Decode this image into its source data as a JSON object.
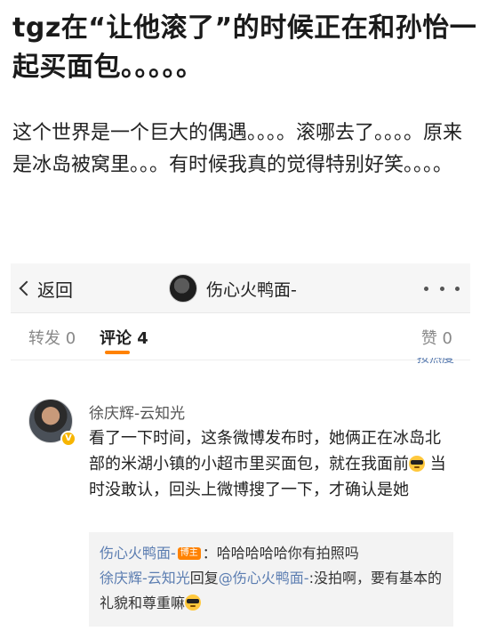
{
  "post": {
    "title": "tgz在“让他滚了”的时候正在和孙怡一起买面包。。。。。",
    "body": "这个世界是一个巨大的偶遇。。。。滚哪去了。。。。原来是冰岛被窝里。。。有时候我真的觉得特别好笑。。。。"
  },
  "navbar": {
    "back_label": "返回",
    "title": "伤心火鸭面-"
  },
  "tabs": {
    "repost": "转发 0",
    "comment": "评论 4",
    "like": "赞 0",
    "sort_hint": "按热度"
  },
  "comment": {
    "author": "徐庆辉-云知光",
    "text_part1": "看了一下时间，这条微博发布时，她俩正在冰岛北部的米湖小镇的小超市里买面包，就在我面前",
    "text_part2": " 当时没敢认，回头上微博搜了一下，才确认是她",
    "emoji_name": "cool-sunglasses-emoji",
    "verify_color": "#f7b500"
  },
  "replies": [
    {
      "author": "伤心火鸭面-",
      "tag": "博主",
      "text": "：哈哈哈哈哈你有拍照吗"
    },
    {
      "author": "徐庆辉-云知光",
      "mid": "回复",
      "mention": "@伤心火鸭面-",
      "text": ":没拍啊，要有基本的礼貌和尊重嘛"
    }
  ],
  "colors": {
    "accent": "#ff8200",
    "link": "#5b7db1"
  }
}
